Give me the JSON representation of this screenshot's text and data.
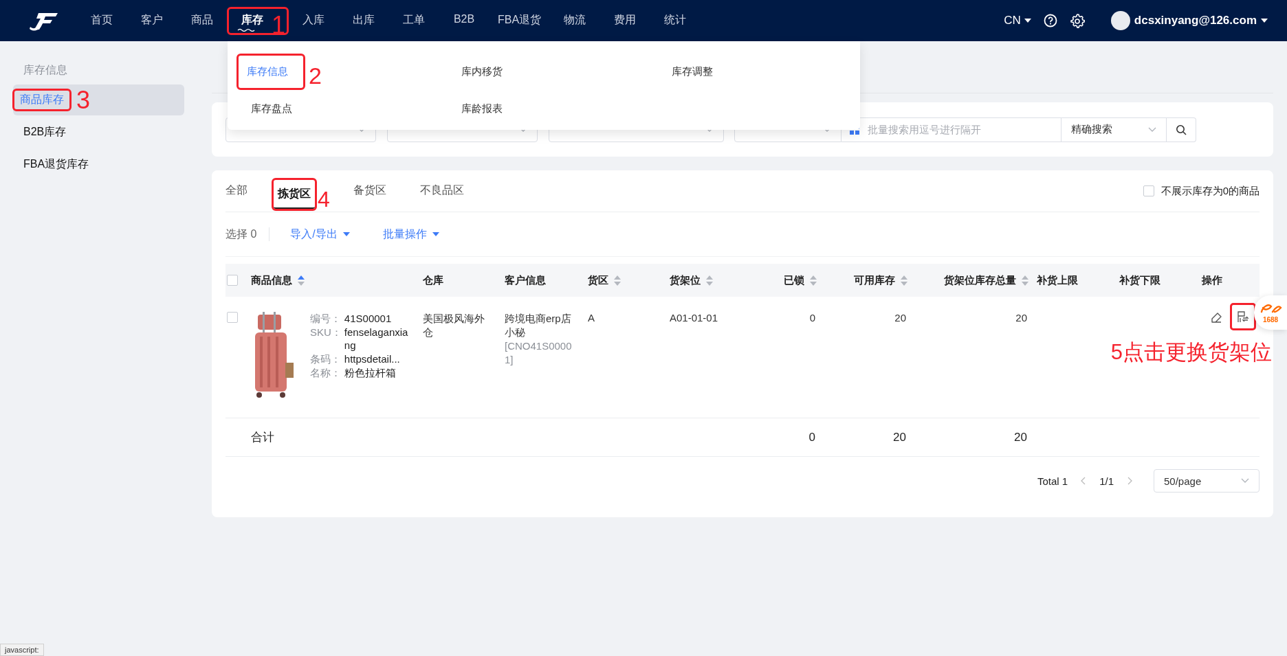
{
  "nav": {
    "items": [
      {
        "label": "首页",
        "selected": false
      },
      {
        "label": "客户",
        "selected": false
      },
      {
        "label": "商品",
        "selected": false
      },
      {
        "label": "库存",
        "selected": true,
        "annotation": "1"
      },
      {
        "label": "入库",
        "selected": false
      },
      {
        "label": "出库",
        "selected": false
      },
      {
        "label": "工单",
        "selected": false
      },
      {
        "label": "B2B",
        "selected": false
      },
      {
        "label": "FBA退货",
        "selected": false
      },
      {
        "label": "物流",
        "selected": false
      },
      {
        "label": "费用",
        "selected": false
      },
      {
        "label": "统计",
        "selected": false
      }
    ],
    "language": "CN",
    "language_expanded": false,
    "user": "dcsxinyang@126.com"
  },
  "menu": {
    "items": [
      {
        "label": "库存信息",
        "selected": true,
        "annotation": "2"
      },
      {
        "label": "库内移货",
        "selected": false
      },
      {
        "label": "库存调整",
        "selected": false
      },
      {
        "label": "库存盘点",
        "selected": false
      },
      {
        "label": "库龄报表",
        "selected": false
      }
    ]
  },
  "sidebar": {
    "heading": "库存信息",
    "items": [
      {
        "label": "商品库存",
        "selected": true,
        "annotation": "3"
      },
      {
        "label": "B2B库存",
        "selected": false
      },
      {
        "label": "FBA退货库存",
        "selected": false
      }
    ]
  },
  "filters": {
    "selects": [
      {
        "kind": "select"
      },
      {
        "kind": "select"
      },
      {
        "kind": "select"
      },
      {
        "kind": "select"
      }
    ],
    "search_placeholder": "批量搜索用逗号进行隔开",
    "match_mode": "精确搜索"
  },
  "tabs": [
    {
      "label": "全部",
      "selected": false
    },
    {
      "label": "拣货区",
      "selected": true,
      "annotation": "4"
    },
    {
      "label": "备货区",
      "selected": false
    },
    {
      "label": "不良品区",
      "selected": false
    }
  ],
  "hide_zero": {
    "label": "不展示库存为0的商品",
    "checked": false
  },
  "toolbar": {
    "selection_label": "选择",
    "selection_count": "0",
    "actions": [
      "导入/导出",
      "批量操作"
    ]
  },
  "table": {
    "all_checked": false,
    "columns": [
      {
        "label": "商品信息",
        "sortable": true,
        "sorted": true
      },
      {
        "label": "仓库"
      },
      {
        "label": "客户信息"
      },
      {
        "label": "货区",
        "sortable": true,
        "sorted": false
      },
      {
        "label": "货架位",
        "sortable": true,
        "sorted": false
      },
      {
        "label": "已锁",
        "sortable": true,
        "sorted": false
      },
      {
        "label": "可用库存",
        "sortable": true,
        "sorted": false
      },
      {
        "label": "货架位库存总量",
        "sortable": true,
        "sorted": false
      },
      {
        "label": "补货上限"
      },
      {
        "label": "补货下限"
      },
      {
        "label": "操作"
      }
    ],
    "rows": [
      {
        "checked": false,
        "image": {
          "kind": "picture"
        },
        "fields": [
          {
            "label": "编号：",
            "value": "41S00001"
          },
          {
            "label": "SKU：",
            "value": "fenselaganxiang"
          },
          {
            "label": "条码：",
            "value": "httpsdetail..."
          },
          {
            "label": "名称：",
            "value": "粉色拉杆箱"
          }
        ],
        "warehouse": "美国极风海外仓",
        "customer": {
          "name": "跨境电商erp店小秘",
          "code": "[CNO41S00001]"
        },
        "zone": "A",
        "shelf": "A01-01-01",
        "locked": "0",
        "available": "20",
        "shelf_total": "20",
        "actions": [
          {
            "kind": "edit"
          },
          {
            "kind": "change-shelf",
            "annotation": "5点击更换货架位"
          }
        ]
      }
    ],
    "summary": {
      "label": "合计",
      "locked": "0",
      "available": "20",
      "shelf_total": "20"
    }
  },
  "pagination": {
    "total": "Total 1",
    "page": "1/1",
    "page_size": "50/page"
  },
  "shortcut": {
    "label": "1688"
  },
  "status_bar": "javascript:"
}
